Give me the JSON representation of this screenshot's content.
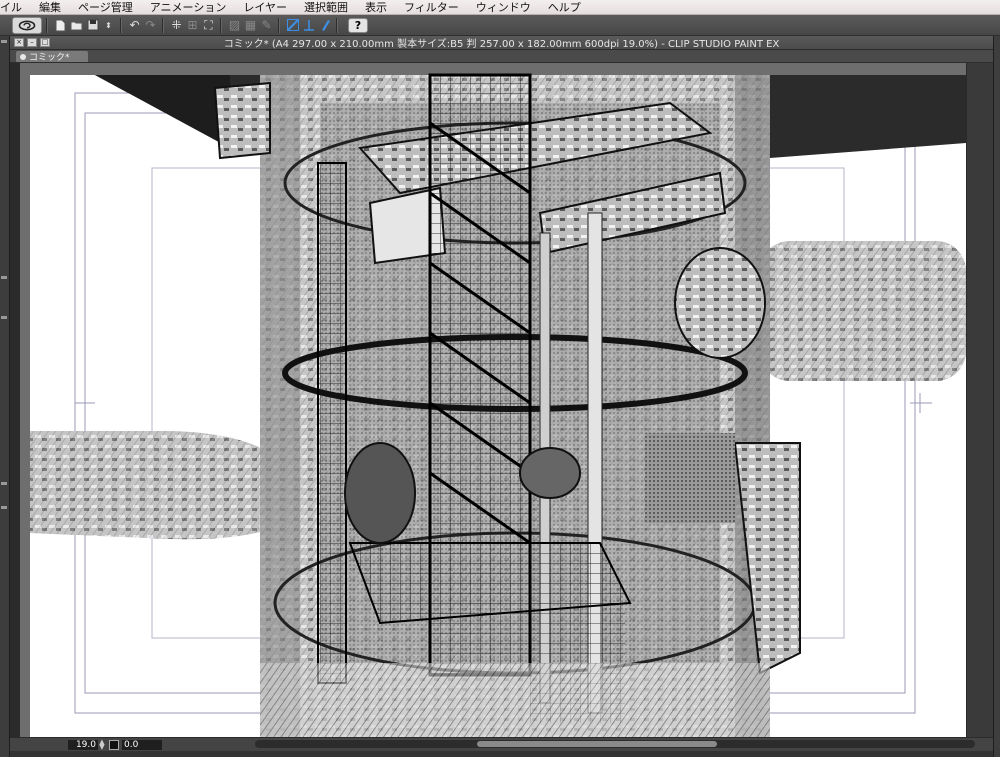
{
  "menubar": {
    "items": [
      "イル",
      "編集",
      "ページ管理",
      "アニメーション",
      "レイヤー",
      "選択範囲",
      "表示",
      "フィルター",
      "ウィンドウ",
      "ヘルプ"
    ]
  },
  "toolbar": {
    "icons": [
      "clip-studio-logo-icon",
      "new-page-icon",
      "open-folder-icon",
      "save-icon",
      "save-options-icon",
      "undo-icon",
      "redo-icon",
      "select-move-icon",
      "transform-icon",
      "scale-icon",
      "disabled-tool-icon",
      "disabled-tool-2-icon",
      "ruler-snap-icon",
      "special-ruler-icon",
      "pen-tool-icon",
      "help-icon"
    ],
    "help_label": "?"
  },
  "document": {
    "title": "コミック* (A4 297.00 x 210.00mm 製本サイズ:B5 判 257.00 x 182.00mm 600dpi 19.0%) - CLIP STUDIO PAINT EX",
    "tab_label": "コミック*"
  },
  "status": {
    "zoom": "19.0",
    "angle": "0.0"
  },
  "colors": {
    "canvas_paper": "#ffffff",
    "frame_line": "#9a9ab5",
    "shade": "#2a2a2a"
  }
}
